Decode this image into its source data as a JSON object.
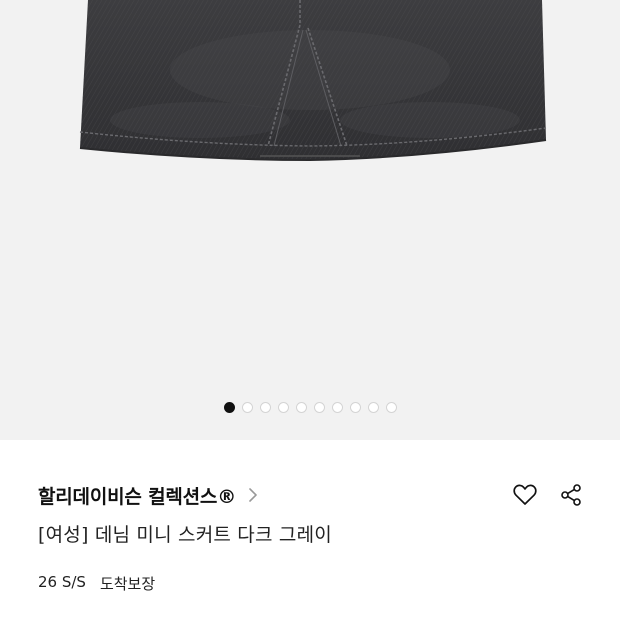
{
  "gallery": {
    "image_alt": "denim mini skirt dark gray",
    "page_indicator": {
      "total": 10,
      "current": 1
    }
  },
  "product": {
    "brand": "할리데이비슨 컬렉션스®",
    "name": "[여성] 데님 미니 스커트 다크 그레이",
    "season": "26 S/S",
    "delivery": "도착보장"
  },
  "icons": {
    "brand_link": "chevron-right-icon",
    "like": "heart-outline-icon",
    "share": "share-icon"
  },
  "colors": {
    "denim": "#3b3b3d",
    "background": "#f2f2f2",
    "dot_active": "#111111",
    "dot_inactive": "#d4d4d4"
  }
}
